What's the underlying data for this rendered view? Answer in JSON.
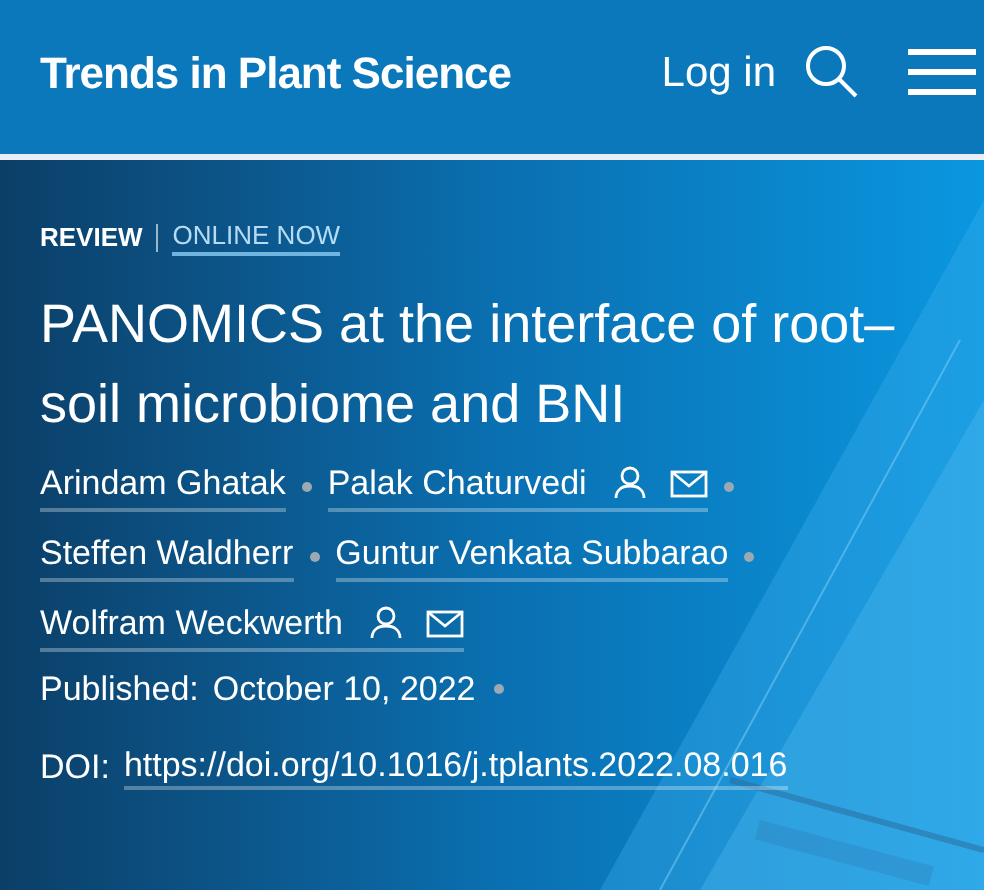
{
  "header": {
    "logo": "Trends in Plant Science",
    "login": "Log in"
  },
  "article": {
    "type": "REVIEW",
    "status": "ONLINE NOW",
    "title": "PANOMICS at the interface of root–soil microbiome and BNI",
    "authors": [
      {
        "name": "Arindam Ghatak",
        "has_profile": false,
        "has_email": false
      },
      {
        "name": "Palak Chaturvedi",
        "has_profile": true,
        "has_email": true
      },
      {
        "name": "Steffen Waldherr",
        "has_profile": false,
        "has_email": false
      },
      {
        "name": "Guntur Venkata Subbarao",
        "has_profile": false,
        "has_email": false
      },
      {
        "name": "Wolfram Weckwerth",
        "has_profile": true,
        "has_email": true
      }
    ],
    "published_label": "Published:",
    "published_date": "October 10, 2022",
    "doi_label": "DOI:",
    "doi": "https://doi.org/10.1016/j.tplants.2022.08.016"
  }
}
